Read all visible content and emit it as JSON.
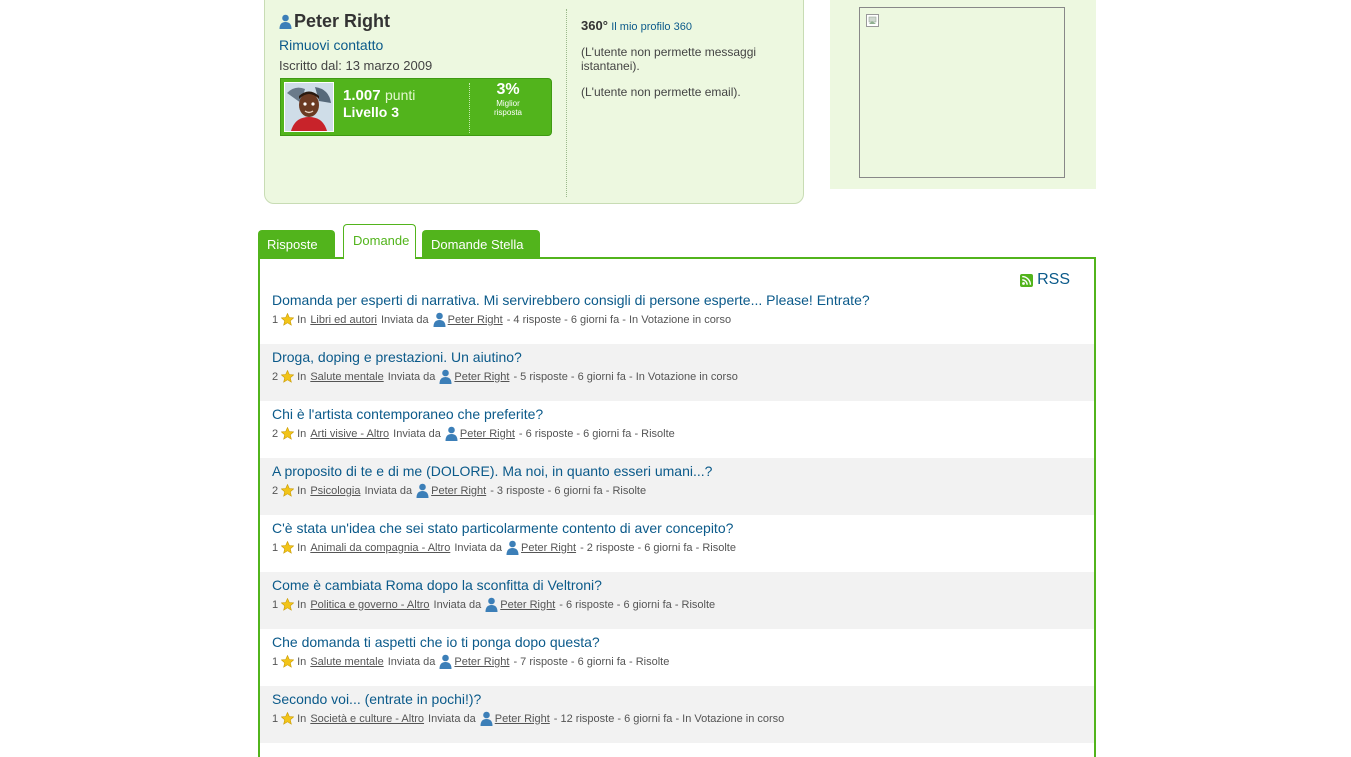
{
  "profile": {
    "name": "Peter Right",
    "remove_contact": "Rimuovi contatto",
    "joined": "Iscritto dal: 13 marzo 2009",
    "points_value": "1.007",
    "points_unit": "punti",
    "level": "Livello 3",
    "best_answer_pct": "3%",
    "best_answer_label_1": "Miglior",
    "best_answer_label_2": "risposta",
    "p360_label": "360°",
    "p360_link": "Il mio profilo 360",
    "notice_messages": "(L'utente non permette messaggi istantanei).",
    "notice_email": "(L'utente non permette email)."
  },
  "tabs": [
    {
      "label": "Risposte",
      "active": false
    },
    {
      "label": "Domande",
      "active": true
    },
    {
      "label": "Domande Stella",
      "active": false
    }
  ],
  "rss_label": "RSS",
  "meta_labels": {
    "in": "In",
    "sent_by": "Inviata da"
  },
  "questions": [
    {
      "title": "Domanda per esperti di narrativa. Mi servirebbero consigli di persone esperte... Please! Entrate?",
      "stars": "1",
      "category": "Libri ed autori",
      "user": "Peter Right",
      "tail": "- 4 risposte - 6 giorni fa - In Votazione in corso"
    },
    {
      "title": "Droga, doping e prestazioni. Un aiutino?",
      "stars": "2",
      "category": "Salute mentale",
      "user": "Peter Right",
      "tail": "- 5 risposte - 6 giorni fa - In Votazione in corso"
    },
    {
      "title": "Chi è l'artista contemporaneo che preferite?",
      "stars": "2",
      "category": "Arti visive - Altro",
      "user": "Peter Right",
      "tail": "- 6 risposte - 6 giorni fa - Risolte"
    },
    {
      "title": "A proposito di te e di me (DOLORE). Ma noi, in quanto esseri umani...?",
      "stars": "2",
      "category": "Psicologia",
      "user": "Peter Right",
      "tail": "- 3 risposte - 6 giorni fa - Risolte"
    },
    {
      "title": "C'è stata un'idea che sei stato particolarmente contento di aver concepito?",
      "stars": "1",
      "category": "Animali da compagnia - Altro",
      "user": "Peter Right",
      "tail": "- 2 risposte - 6 giorni fa - Risolte"
    },
    {
      "title": "Come è cambiata Roma dopo la sconfitta di Veltroni?",
      "stars": "1",
      "category": "Politica e governo - Altro",
      "user": "Peter Right",
      "tail": "- 6 risposte - 6 giorni fa - Risolte"
    },
    {
      "title": "Che domanda ti aspetti che io ti ponga dopo questa?",
      "stars": "1",
      "category": "Salute mentale",
      "user": "Peter Right",
      "tail": "- 7 risposte - 6 giorni fa - Risolte"
    },
    {
      "title": "Secondo voi... (entrate in pochi!)?",
      "stars": "1",
      "category": "Società e culture - Altro",
      "user": "Peter Right",
      "tail": "- 12 risposte - 6 giorni fa - In Votazione in corso"
    }
  ]
}
